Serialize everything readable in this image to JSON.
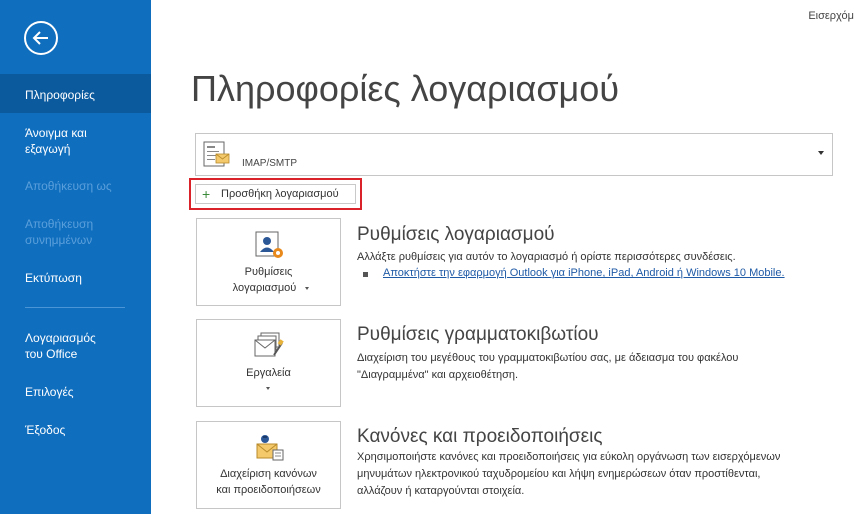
{
  "header": {
    "right_text": "Εισερχόμ"
  },
  "sidebar": {
    "back_icon": "back-arrow-icon",
    "items": [
      {
        "label": "Πληροφορίες",
        "active": true
      },
      {
        "label": "Άνοιγμα και εξαγωγή"
      },
      {
        "label": "Αποθήκευση ως",
        "disabled": true
      },
      {
        "label": "Αποθήκευση συνημμένων",
        "disabled": true
      },
      {
        "label": "Εκτύπωση"
      },
      {
        "label": "Λογαριασμός του Office"
      },
      {
        "label": "Επιλογές"
      },
      {
        "label": "Έξοδος"
      }
    ]
  },
  "main": {
    "title": "Πληροφορίες λογαριασμού",
    "account_selector": {
      "value": "IMAP/SMTP"
    },
    "add_account": {
      "label": "Προσθήκη λογαριασμού",
      "highlight_color": "#d9222a"
    },
    "sections": [
      {
        "button_line1": "Ρυθμίσεις",
        "button_line2": "λογαριασμού",
        "title": "Ρυθμίσεις λογαριασμού",
        "description": "Αλλάξτε ρυθμίσεις για αυτόν το λογαριασμό ή ορίστε περισσότερες συνδέσεις.",
        "link": "Αποκτήστε την εφαρμογή Outlook για iPhone, iPad, Android ή Windows 10 Mobile."
      },
      {
        "button_line1": "Εργαλεία",
        "title": "Ρυθμίσεις γραμματοκιβωτίου",
        "description": "Διαχείριση του μεγέθους του γραμματοκιβωτίου σας, με άδειασμα του φακέλου \"Διαγραμμένα\" και αρχειοθέτηση."
      },
      {
        "button_line1": "Διαχείριση κανόνων",
        "button_line2": "και προειδοποιήσεων",
        "title": "Κανόνες και προειδοποιήσεις",
        "description": "Χρησιμοποιήστε κανόνες και προειδοποιήσεις για εύκολη οργάνωση των εισερχόμενων μηνυμάτων ηλεκτρονικού ταχυδρομείου και λήψη ενημερώσεων όταν προστίθενται, αλλάζουν ή καταργούνται στοιχεία."
      }
    ]
  },
  "colors": {
    "sidebar": "#106ebe",
    "sidebar_active": "#0c5a9e",
    "link": "#1f5aa6"
  }
}
